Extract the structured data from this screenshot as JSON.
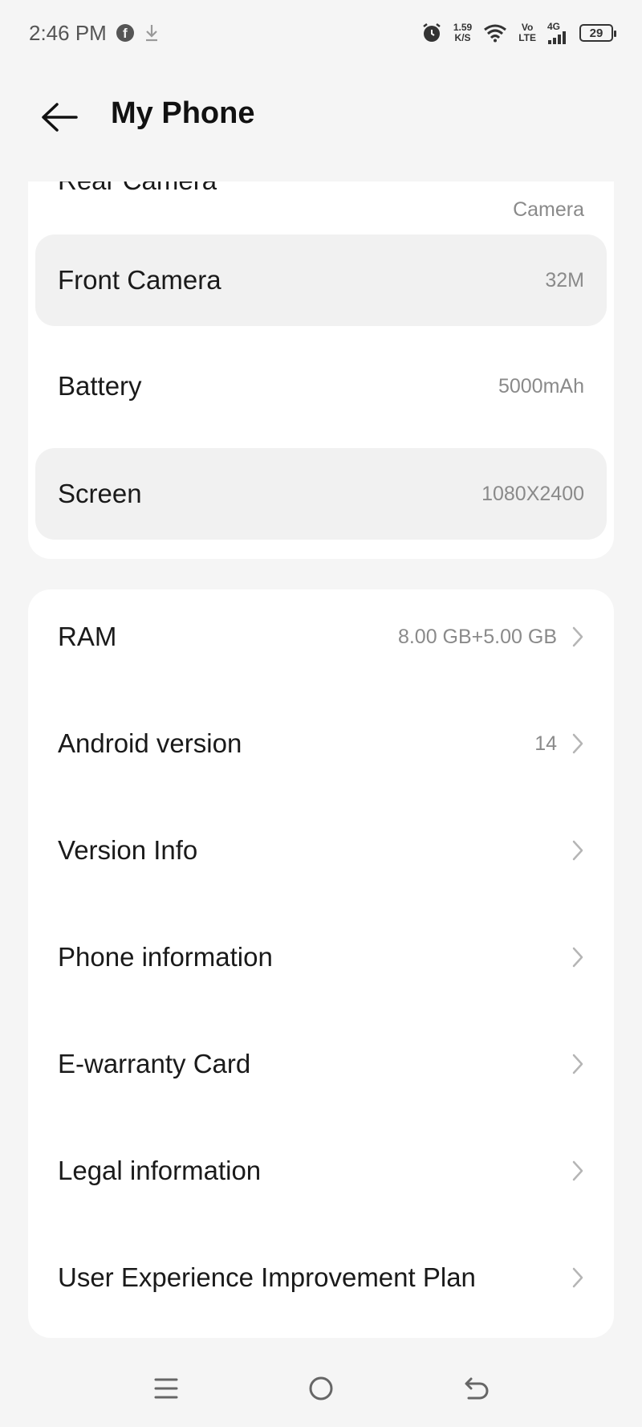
{
  "status_bar": {
    "time": "2:46 PM",
    "net_speed_value": "1.59",
    "net_speed_unit": "K/S",
    "volte_top": "Vo",
    "volte_bottom": "LTE",
    "network_type": "4G",
    "battery_level": "29"
  },
  "header": {
    "title": "My Phone"
  },
  "hardware_card": {
    "partial_label": "Rear Camera",
    "partial_value": "Camera",
    "rows": [
      {
        "label": "Front Camera",
        "value": "32M"
      },
      {
        "label": "Battery",
        "value": "5000mAh"
      },
      {
        "label": "Screen",
        "value": "1080X2400"
      }
    ]
  },
  "info_card": {
    "rows": [
      {
        "label": "RAM",
        "value": "8.00 GB+5.00 GB"
      },
      {
        "label": "Android version",
        "value": "14"
      },
      {
        "label": "Version Info",
        "value": ""
      },
      {
        "label": "Phone information",
        "value": ""
      },
      {
        "label": "E-warranty Card",
        "value": ""
      },
      {
        "label": "Legal information",
        "value": ""
      },
      {
        "label": "User Experience Improvement Plan",
        "value": ""
      }
    ]
  },
  "colors": {
    "background": "#f5f5f5",
    "card": "#ffffff",
    "highlight_row": "#f1f1f1",
    "secondary_text": "#8a8a8a"
  }
}
